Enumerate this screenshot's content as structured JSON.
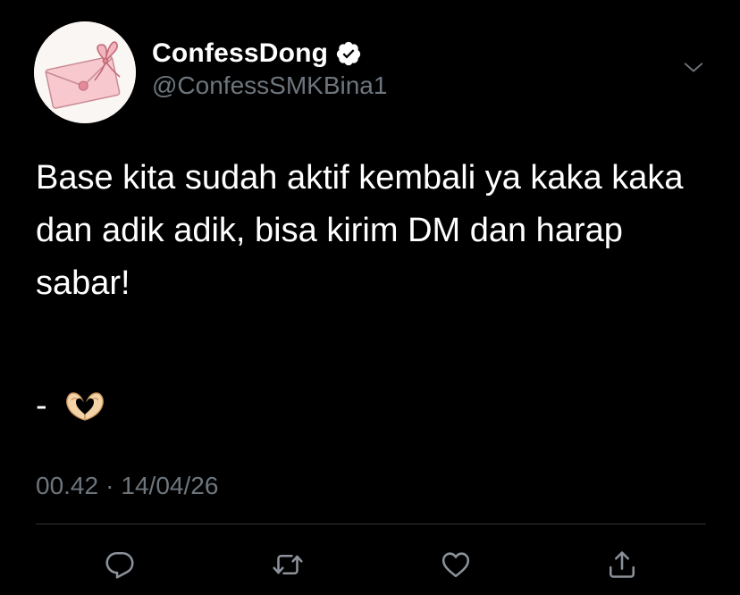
{
  "tweet": {
    "display_name": "ConfessDong",
    "verified": true,
    "handle": "@ConfessSMKBina1",
    "text": "Base kita sudah aktif kembali ya kaka kaka dan adik adik, bisa kirim DM dan harap sabar!",
    "signature_dash": "-",
    "signature_emoji": "heart-hands-emoji",
    "time": "00.42",
    "separator": "·",
    "date": "14/04/26"
  },
  "icons": {
    "avatar": "envelope-with-bow",
    "verified": "verified-badge-icon",
    "more": "chevron-down-icon",
    "reply": "reply-icon",
    "retweet": "retweet-icon",
    "like": "heart-icon",
    "share": "share-icon"
  },
  "colors": {
    "background": "#000000",
    "primary_text": "#ffffff",
    "secondary_text": "#6e767d",
    "divider": "#2f3336",
    "avatar_bg": "#faf6f3",
    "envelope_pink": "#f7c9cf"
  }
}
